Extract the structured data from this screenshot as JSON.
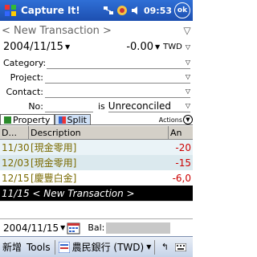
{
  "titlebar": {
    "title": "Capture It!",
    "time": "09:53",
    "ok_label": "ok"
  },
  "form": {
    "nav_title": "< New Transaction >",
    "date": "2004/11/15",
    "amount": "-0.00",
    "currency": "TWD",
    "category_label": "Category:",
    "project_label": "Project:",
    "contact_label": "Contact:",
    "no_label": "No:",
    "is_label": "is",
    "status": "Unreconciled"
  },
  "tabs": {
    "property": "Property",
    "split": "Split",
    "actions": "Actions"
  },
  "table": {
    "headers": [
      "D...",
      "Description",
      "An"
    ],
    "rows": [
      {
        "date": "11/30",
        "desc": "[現金零用]",
        "amt": "-20"
      },
      {
        "date": "12/03",
        "desc": "[現金零用]",
        "amt": "-15"
      },
      {
        "date": "12/15",
        "desc": "[慶豐白金]",
        "amt": "-6,0"
      }
    ],
    "new_row": "11/15 < New Transaction >"
  },
  "bottombar": {
    "date": "2004/11/15",
    "bal_label": "Bal:"
  },
  "menubar": {
    "new_label": "新增",
    "tools_label": "Tools",
    "account": "農民銀行 (TWD)"
  },
  "colors": {
    "titlebar": "#1d4fb0",
    "new_row_bg": "#000000",
    "amount_red": "#cc0000",
    "date_olive": "#7a6a00"
  }
}
